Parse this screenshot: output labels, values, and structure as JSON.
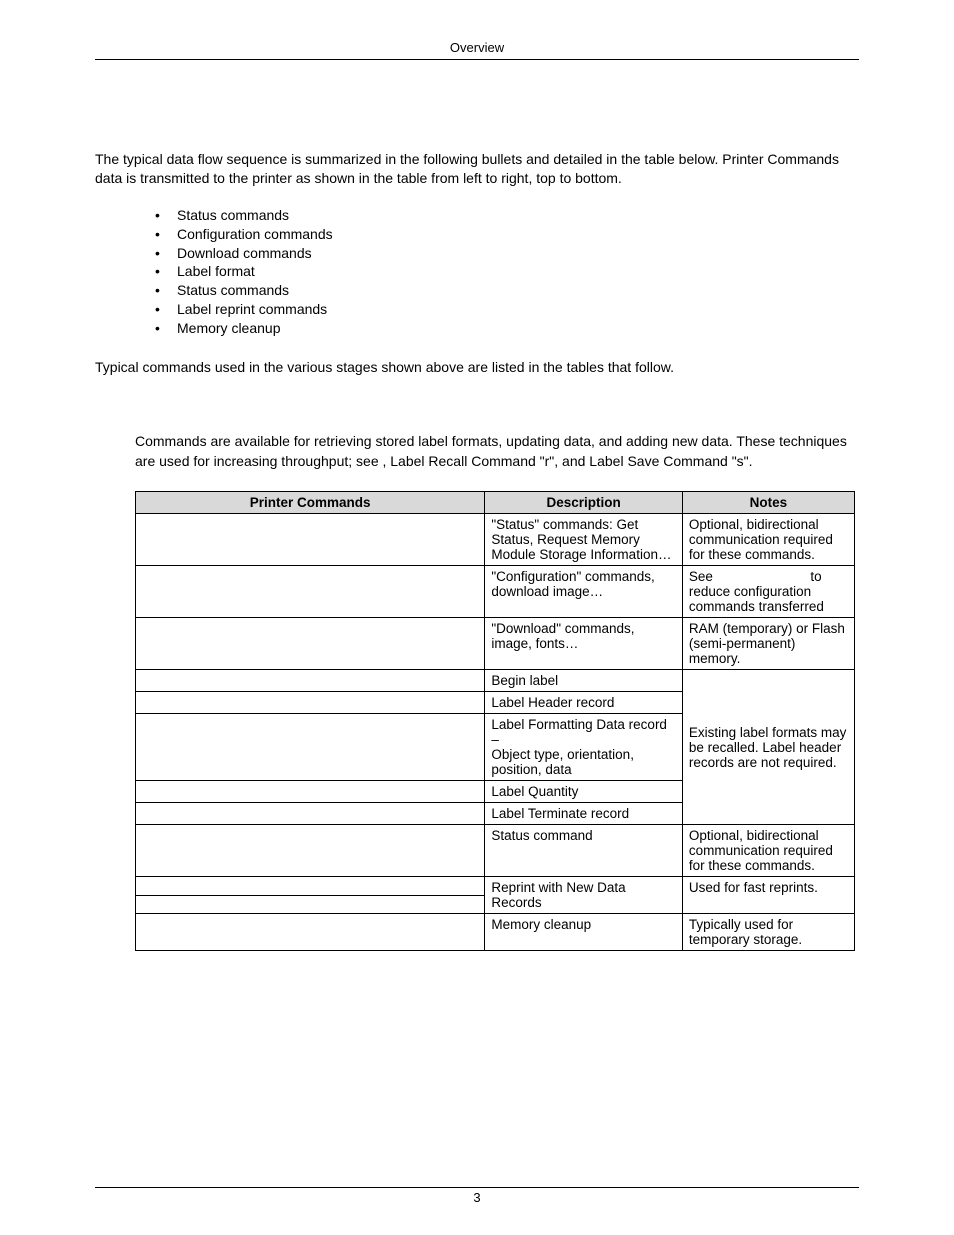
{
  "header": {
    "title": "Overview"
  },
  "intro": "The typical data flow sequence is summarized in the following bullets and detailed in the table below.  Printer Commands data is transmitted to the printer as shown in the table from left to right, top to bottom.",
  "bullets": [
    "Status commands",
    "Configuration commands",
    "Download commands",
    "Label format",
    "Status commands",
    "Label reprint commands",
    "Memory cleanup"
  ],
  "post_list": "Typical commands used in the various stages shown above are listed in the tables that follow.",
  "note_para": "Commands are available for retrieving stored label formats, updating data, and adding new data. These techniques are used for increasing throughput; see          , Label Recall Command \"r\", and Label Save Command \"s\".",
  "table": {
    "headers": {
      "pc": "Printer Commands",
      "desc": "Description",
      "notes": "Notes"
    },
    "rows": {
      "r1": {
        "pc": "",
        "desc": "\"Status\" commands: Get Status, Request Memory Module Storage Information…",
        "notes": "Optional, bidirectional communication required for these commands."
      },
      "r2": {
        "pc": "",
        "desc": "\"Configuration\" commands, download image…",
        "notes_pre": "See",
        "notes_post": "to",
        "notes_rest": "reduce configuration commands transferred"
      },
      "r3": {
        "pc": "",
        "desc": "\"Download\" commands, image, fonts…",
        "notes": "RAM (temporary) or Flash (semi-permanent) memory."
      },
      "r4": {
        "pc": "",
        "desc": "Begin label"
      },
      "r5": {
        "pc": "",
        "desc": "Label Header record"
      },
      "r6": {
        "pc": "",
        "desc": "Label Formatting Data record –\nObject type, orientation, position, data"
      },
      "r7": {
        "pc": "",
        "desc": "Label Quantity"
      },
      "r8": {
        "pc": "",
        "desc": "Label Terminate record"
      },
      "label_notes": "Existing label formats may be recalled.  Label header records are not required.",
      "r9": {
        "pc": "",
        "desc": "Status command",
        "notes": "Optional, bidirectional communication required for these commands."
      },
      "r10a": {
        "pc": ""
      },
      "r10b": {
        "pc": ""
      },
      "r10_desc": "Reprint with New Data Records",
      "r10_notes": "Used for fast reprints.",
      "r11": {
        "pc": "",
        "desc": "Memory cleanup",
        "notes": "Typically used for temporary storage."
      }
    }
  },
  "footer": {
    "page": "3"
  }
}
